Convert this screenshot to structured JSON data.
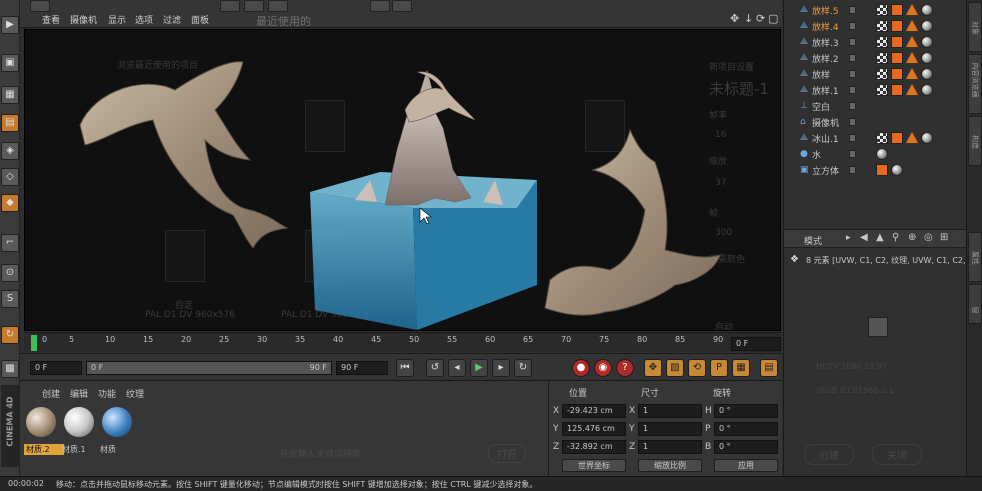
{
  "menu": {
    "items": [
      "查看",
      "摄像机",
      "显示",
      "选项",
      "过滤",
      "面板"
    ],
    "faded_tab": "最近使用的"
  },
  "viewport": {
    "ghost_texts": {
      "recent_title": "浏览最近使用的项目",
      "file1": "自定",
      "file2": "自定",
      "file1_sub": "PAL D1 DV 960x576",
      "file2_sub": "PAL D1 DV 960x576",
      "right_title": "新项目设置",
      "right_name": "未标题-1",
      "fps_label": "帧率",
      "fps_val": "16",
      "zoom_label": "缩放",
      "zoom_val": "37",
      "frames_label": "帧",
      "frames_val": "300",
      "bg_label": "背景颜色",
      "bg_val": "自动"
    },
    "cursor": "mouse-pointer"
  },
  "timeline": {
    "ticks": [
      "0",
      "5",
      "10",
      "15",
      "20",
      "25",
      "30",
      "35",
      "40",
      "45",
      "50",
      "55",
      "60",
      "65",
      "70",
      "75",
      "80",
      "85",
      "90"
    ],
    "current_frame": "0 F"
  },
  "transport": {
    "start_field": "0 F",
    "range_start": "0 F",
    "range_end": "90 F",
    "end_field": "90 F"
  },
  "materials": {
    "tabs": [
      "创建",
      "编辑",
      "功能",
      "纹理"
    ],
    "items": [
      {
        "label": "材质.2",
        "color": "#a08a70"
      },
      {
        "label": "材质.1",
        "color": "#c9c9c9"
      },
      {
        "label": "材质",
        "color": "#3d7fc0"
      }
    ],
    "ghost_search": "在此输入关键词搜索",
    "ghost_open": "打开"
  },
  "coordinates": {
    "headers": [
      "位置",
      "尺寸",
      "旋转"
    ],
    "rows": [
      {
        "axis": "X",
        "pos": "-29.423 cm",
        "size": "1",
        "rot_axis": "H",
        "rot": "0 °"
      },
      {
        "axis": "Y",
        "pos": "125.476 cm",
        "size": "1",
        "rot_axis": "P",
        "rot": "0 °"
      },
      {
        "axis": "Z",
        "pos": "-32.892 cm",
        "size": "1",
        "rot_axis": "B",
        "rot": "0 °"
      }
    ],
    "world_label": "世界坐标",
    "scale_label": "缩放比例",
    "apply_label": "应用"
  },
  "status": {
    "time": "00:00:02",
    "message": "移动：点击并拖动鼠标移动元素。按住 SHIFT 键量化移动；节点编辑模式时按住 SHIFT 键增加选择对象；按住 CTRL 键减少选择对象。"
  },
  "objects": [
    {
      "name": "放样.5",
      "icon": "loft-icon",
      "highlight": true,
      "indent": 0
    },
    {
      "name": "放样.4",
      "icon": "loft-icon",
      "highlight": true,
      "indent": 0
    },
    {
      "name": "放样.3",
      "icon": "loft-icon",
      "highlight": false,
      "indent": 0
    },
    {
      "name": "放样.2",
      "icon": "loft-icon",
      "highlight": false,
      "indent": 0
    },
    {
      "name": "放样",
      "icon": "loft-icon",
      "highlight": false,
      "indent": 0
    },
    {
      "name": "放样.1",
      "icon": "loft-icon",
      "highlight": false,
      "indent": 0
    },
    {
      "name": "空白",
      "icon": "null-icon",
      "highlight": false,
      "indent": 0
    },
    {
      "name": "摄像机",
      "icon": "camera-icon",
      "highlight": false,
      "indent": 0
    },
    {
      "name": "冰山.1",
      "icon": "loft-icon",
      "highlight": false,
      "indent": 0
    },
    {
      "name": "水",
      "icon": "sphere-icon",
      "highlight": false,
      "indent": 0
    },
    {
      "name": "立方体",
      "icon": "cube-icon",
      "highlight": false,
      "indent": 0
    }
  ],
  "attributes": {
    "mode_label": "模式",
    "element_text": "8 元素 [UVW, C1, C2, 纹理, UVW, C1, C2,",
    "ghost_info": "HDTV 1080 29.97",
    "ghost_color": "sRGB IEC61966-2.1",
    "ghost_create": "创建",
    "ghost_close": "关闭"
  },
  "sidetabs": [
    "对象",
    "内容浏览器",
    "构造",
    "属性",
    "层"
  ],
  "colors": {
    "accent_orange": "#e0a43a",
    "highlight_text": "#e8a03a",
    "play_green": "#4fd06a",
    "record_red": "#b02a2a"
  }
}
